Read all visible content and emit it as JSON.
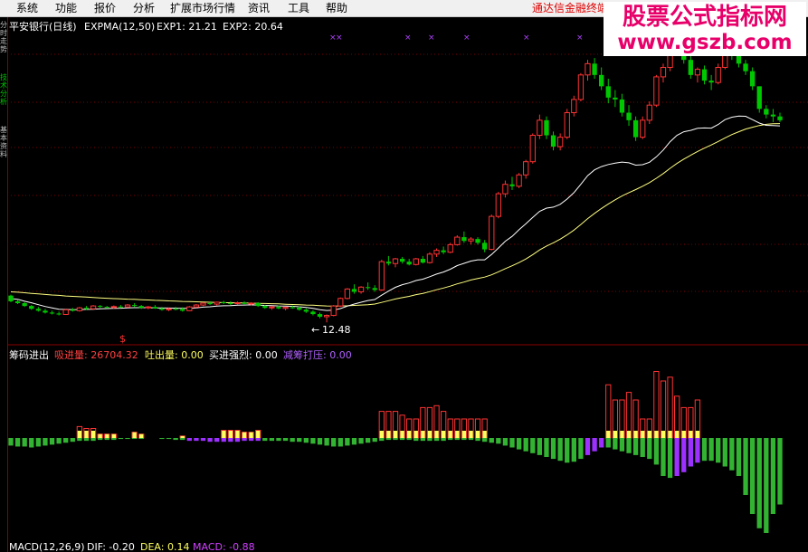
{
  "menu": [
    "系统",
    "功能",
    "报价",
    "分析",
    "扩展市场行情",
    "资讯",
    "工具",
    "帮助"
  ],
  "broker": "通达信金融终端",
  "watermark": {
    "title": "股票公式指标网",
    "url": "www.gszb.com"
  },
  "sidebar_tabs": [
    "分时走势",
    "技术分析",
    "基本资料"
  ],
  "price_panel": {
    "title": "平安银行(日线)",
    "indicator": "EXPMA(12,50)",
    "exp1_label": "EXP1: 21.21",
    "exp2_label": "EXP2: 20.64",
    "low_marker": "12.48",
    "dollar_mark": "$"
  },
  "chip_panel": {
    "title": "筹码进出",
    "absorb_label": "吸进量: 26704.32",
    "release_label": "吐出量: 0.00",
    "buy_strength_label": "买进强烈: 0.00",
    "reduce_label": "减筹打压: 0.00"
  },
  "macd_panel": {
    "label": "MACD(12,26,9)",
    "dif_label": "DIF: -0.20",
    "dea_label": "DEA: 0.14",
    "macd_label": "MACD: -0.88"
  },
  "colors": {
    "up": "#ff3333",
    "down": "#00c800",
    "exp1": "#ffffff",
    "exp2": "#ffff80",
    "purple": "#9b30ff",
    "yellow": "#ffff60",
    "green_bar": "#32b432"
  },
  "chart_data": {
    "type": "candlestick",
    "candles": [
      [
        13.9,
        13.95,
        13.55,
        13.6
      ],
      [
        13.6,
        13.7,
        13.45,
        13.5
      ],
      [
        13.5,
        13.55,
        13.3,
        13.35
      ],
      [
        13.35,
        13.4,
        13.15,
        13.2
      ],
      [
        13.2,
        13.3,
        13.05,
        13.1
      ],
      [
        13.1,
        13.2,
        12.95,
        13.0
      ],
      [
        13.0,
        13.1,
        12.9,
        12.95
      ],
      [
        12.95,
        13.05,
        12.85,
        12.9
      ],
      [
        12.9,
        13.2,
        12.88,
        13.15
      ],
      [
        13.15,
        13.25,
        13.05,
        13.1
      ],
      [
        13.1,
        13.3,
        13.05,
        13.25
      ],
      [
        13.25,
        13.35,
        13.15,
        13.2
      ],
      [
        13.2,
        13.4,
        13.15,
        13.35
      ],
      [
        13.35,
        13.4,
        13.25,
        13.3
      ],
      [
        13.3,
        13.35,
        13.22,
        13.28
      ],
      [
        13.28,
        13.38,
        13.2,
        13.32
      ],
      [
        13.32,
        13.4,
        13.25,
        13.3
      ],
      [
        13.3,
        13.45,
        13.26,
        13.4
      ],
      [
        13.4,
        13.5,
        13.3,
        13.35
      ],
      [
        13.35,
        13.4,
        13.2,
        13.25
      ],
      [
        13.25,
        13.35,
        13.18,
        13.3
      ],
      [
        13.3,
        13.4,
        13.2,
        13.22
      ],
      [
        13.22,
        13.3,
        13.1,
        13.15
      ],
      [
        13.15,
        13.25,
        13.08,
        13.2
      ],
      [
        13.2,
        13.3,
        13.12,
        13.18
      ],
      [
        13.18,
        13.28,
        13.05,
        13.1
      ],
      [
        13.1,
        13.35,
        13.08,
        13.3
      ],
      [
        13.3,
        13.45,
        13.25,
        13.4
      ],
      [
        13.4,
        13.55,
        13.35,
        13.5
      ],
      [
        13.5,
        13.6,
        13.4,
        13.45
      ],
      [
        13.45,
        13.58,
        13.38,
        13.55
      ],
      [
        13.55,
        13.62,
        13.45,
        13.5
      ],
      [
        13.5,
        13.6,
        13.4,
        13.48
      ],
      [
        13.48,
        13.58,
        13.42,
        13.52
      ],
      [
        13.52,
        13.6,
        13.44,
        13.46
      ],
      [
        13.46,
        13.55,
        13.38,
        13.5
      ],
      [
        13.5,
        13.55,
        13.3,
        13.35
      ],
      [
        13.35,
        13.4,
        13.2,
        13.25
      ],
      [
        13.25,
        13.35,
        13.15,
        13.3
      ],
      [
        13.3,
        13.38,
        13.18,
        13.22
      ],
      [
        13.22,
        13.32,
        13.12,
        13.28
      ],
      [
        13.28,
        13.38,
        13.2,
        13.26
      ],
      [
        13.26,
        13.34,
        13.1,
        13.15
      ],
      [
        13.15,
        13.22,
        12.98,
        13.05
      ],
      [
        13.05,
        13.12,
        12.85,
        12.92
      ],
      [
        12.92,
        13.0,
        12.7,
        12.78
      ],
      [
        12.78,
        12.9,
        12.48,
        12.85
      ],
      [
        12.85,
        13.4,
        12.8,
        13.35
      ],
      [
        13.35,
        13.8,
        13.3,
        13.75
      ],
      [
        13.75,
        14.3,
        13.7,
        14.25
      ],
      [
        14.25,
        14.5,
        14.0,
        14.1
      ],
      [
        14.1,
        14.4,
        14.0,
        14.35
      ],
      [
        14.35,
        14.6,
        14.2,
        14.3
      ],
      [
        14.3,
        14.45,
        14.1,
        14.2
      ],
      [
        14.2,
        15.8,
        14.15,
        15.7
      ],
      [
        15.7,
        16.0,
        15.5,
        15.6
      ],
      [
        15.6,
        15.9,
        15.4,
        15.85
      ],
      [
        15.85,
        15.95,
        15.6,
        15.7
      ],
      [
        15.7,
        15.85,
        15.5,
        15.55
      ],
      [
        15.55,
        15.9,
        15.5,
        15.85
      ],
      [
        15.85,
        16.0,
        15.6,
        15.65
      ],
      [
        15.65,
        16.2,
        15.6,
        16.1
      ],
      [
        16.1,
        16.4,
        15.95,
        16.3
      ],
      [
        16.3,
        16.5,
        16.1,
        16.2
      ],
      [
        16.2,
        16.7,
        16.15,
        16.6
      ],
      [
        16.6,
        17.1,
        16.55,
        17.0
      ],
      [
        17.0,
        17.3,
        16.7,
        16.8
      ],
      [
        16.8,
        17.0,
        16.6,
        16.9
      ],
      [
        16.9,
        17.0,
        16.6,
        16.7
      ],
      [
        16.7,
        16.85,
        16.2,
        16.35
      ],
      [
        16.35,
        18.2,
        16.3,
        18.1
      ],
      [
        18.1,
        19.4,
        18.0,
        19.3
      ],
      [
        19.3,
        20.0,
        19.1,
        19.8
      ],
      [
        19.8,
        20.2,
        19.5,
        19.7
      ],
      [
        19.7,
        20.4,
        19.6,
        20.3
      ],
      [
        20.3,
        21.1,
        20.1,
        21.0
      ],
      [
        21.0,
        22.5,
        20.9,
        22.4
      ],
      [
        22.4,
        23.5,
        22.2,
        23.2
      ],
      [
        23.2,
        23.4,
        22.2,
        22.4
      ],
      [
        22.4,
        22.6,
        21.6,
        21.8
      ],
      [
        21.8,
        22.5,
        21.6,
        22.3
      ],
      [
        22.3,
        23.8,
        22.2,
        23.6
      ],
      [
        23.6,
        24.5,
        23.4,
        24.3
      ],
      [
        24.3,
        25.7,
        24.2,
        25.6
      ],
      [
        25.6,
        26.4,
        25.3,
        26.2
      ],
      [
        26.2,
        26.5,
        25.4,
        25.6
      ],
      [
        25.6,
        26.0,
        24.8,
        25.0
      ],
      [
        25.0,
        25.4,
        24.1,
        24.4
      ],
      [
        24.4,
        24.8,
        23.9,
        24.3
      ],
      [
        24.3,
        24.6,
        23.4,
        23.6
      ],
      [
        23.6,
        24.0,
        22.9,
        23.2
      ],
      [
        23.2,
        23.4,
        22.1,
        22.3
      ],
      [
        22.3,
        23.4,
        22.2,
        23.2
      ],
      [
        23.2,
        24.2,
        23.0,
        24.0
      ],
      [
        24.0,
        25.6,
        23.9,
        25.5
      ],
      [
        25.5,
        26.2,
        25.2,
        26.0
      ],
      [
        26.0,
        27.6,
        25.8,
        27.4
      ],
      [
        27.4,
        28.1,
        27.0,
        27.3
      ],
      [
        27.3,
        27.6,
        26.2,
        26.4
      ],
      [
        26.4,
        26.8,
        25.4,
        25.6
      ],
      [
        25.6,
        26.0,
        25.2,
        25.9
      ],
      [
        25.9,
        26.1,
        25.1,
        25.3
      ],
      [
        25.3,
        25.6,
        24.8,
        25.2
      ],
      [
        25.2,
        26.2,
        25.1,
        26.0
      ],
      [
        26.0,
        27.0,
        25.9,
        26.8
      ],
      [
        26.8,
        27.2,
        26.4,
        26.6
      ],
      [
        26.6,
        27.0,
        26.0,
        26.2
      ],
      [
        26.2,
        26.4,
        25.6,
        25.8
      ],
      [
        25.8,
        26.0,
        24.8,
        25.0
      ],
      [
        25.0,
        24.8,
        23.6,
        23.8
      ],
      [
        23.8,
        24.0,
        23.3,
        23.5
      ],
      [
        23.5,
        23.8,
        23.1,
        23.4
      ],
      [
        23.4,
        23.6,
        23.1,
        23.2
      ]
    ],
    "exp1": [
      13.74,
      13.7,
      13.6,
      13.52,
      13.42,
      13.32,
      13.25,
      13.18,
      13.17,
      13.15,
      13.16,
      13.17,
      13.18,
      13.2,
      13.21,
      13.22,
      13.23,
      13.25,
      13.26,
      13.26,
      13.26,
      13.25,
      13.24,
      13.24,
      13.23,
      13.22,
      13.23,
      13.25,
      13.29,
      13.31,
      13.34,
      13.36,
      13.37,
      13.39,
      13.4,
      13.41,
      13.4,
      13.38,
      13.37,
      13.35,
      13.34,
      13.33,
      13.31,
      13.27,
      13.22,
      13.15,
      13.11,
      13.13,
      13.21,
      13.34,
      13.45,
      13.55,
      13.64,
      13.69,
      13.92,
      14.14,
      14.34,
      14.48,
      14.57,
      14.7,
      14.77,
      14.9,
      15.04,
      15.15,
      15.3,
      15.49,
      15.61,
      15.73,
      15.8,
      15.8,
      16.08,
      16.42,
      16.78,
      17.04,
      17.39,
      17.71,
      18.05,
      18.37,
      18.54,
      18.59,
      18.74,
      19.02,
      19.36,
      19.8,
      20.26,
      20.57,
      20.74,
      20.85,
      20.93,
      20.98,
      20.94,
      20.82,
      20.84,
      20.97,
      21.26,
      21.62,
      22.06,
      22.4,
      22.59,
      22.66,
      22.77,
      22.79,
      22.78,
      22.97,
      23.23,
      23.36,
      23.42,
      23.41,
      23.23,
      23.05,
      22.93,
      22.92,
      22.9
    ],
    "exp2": [
      14.1,
      14.08,
      14.05,
      14.02,
      13.99,
      13.96,
      13.93,
      13.91,
      13.88,
      13.86,
      13.84,
      13.82,
      13.8,
      13.78,
      13.76,
      13.74,
      13.73,
      13.71,
      13.7,
      13.68,
      13.67,
      13.65,
      13.64,
      13.62,
      13.61,
      13.59,
      13.58,
      13.57,
      13.56,
      13.55,
      13.54,
      13.53,
      13.52,
      13.52,
      13.51,
      13.5,
      13.49,
      13.48,
      13.47,
      13.46,
      13.44,
      13.43,
      13.42,
      13.4,
      13.39,
      13.37,
      13.35,
      13.34,
      13.35,
      13.36,
      13.38,
      13.4,
      13.42,
      13.45,
      13.54,
      13.63,
      13.72,
      13.79,
      13.86,
      13.95,
      14.02,
      14.11,
      14.21,
      14.3,
      14.4,
      14.52,
      14.62,
      14.73,
      14.81,
      14.88,
      15.0,
      15.16,
      15.33,
      15.48,
      15.65,
      15.84,
      16.07,
      16.32,
      16.53,
      16.7,
      16.89,
      17.12,
      17.37,
      17.67,
      17.98,
      18.26,
      18.52,
      18.76,
      18.98,
      19.18,
      19.36,
      19.52,
      19.7,
      19.89,
      20.12,
      20.37,
      20.65,
      20.91,
      21.14,
      21.34,
      21.54,
      21.72,
      21.89,
      22.07,
      22.26,
      22.44,
      22.59,
      22.73,
      22.83,
      22.92,
      22.98,
      23.01,
      23.02
    ],
    "chip_absorb": [
      0,
      0,
      0,
      0,
      0,
      0,
      0,
      0,
      0,
      0,
      6,
      5,
      5,
      2,
      2,
      2,
      0,
      0,
      3,
      2,
      0,
      0,
      0,
      0,
      0,
      1,
      0,
      0,
      0,
      0,
      0,
      4,
      4,
      4,
      3,
      3,
      4,
      0,
      0,
      0,
      0,
      0,
      0,
      0,
      0,
      0,
      0,
      0,
      0,
      0,
      0,
      0,
      0,
      0,
      14,
      14,
      14,
      12,
      10,
      10,
      16,
      16,
      17,
      14,
      10,
      10,
      10,
      10,
      10,
      10,
      0,
      0,
      0,
      0,
      0,
      0,
      0,
      0,
      0,
      0,
      0,
      0,
      0,
      0,
      0,
      0,
      0,
      28,
      20,
      20,
      24,
      20,
      10,
      10,
      35,
      30,
      32,
      22,
      16,
      16,
      20,
      0,
      0,
      0,
      0,
      0,
      0,
      0,
      0,
      0,
      0,
      0,
      0
    ],
    "chip_yellow": [
      0,
      0,
      0,
      0,
      0,
      0,
      0,
      0,
      0,
      0,
      0,
      0,
      0,
      0,
      0,
      0,
      0,
      0,
      0,
      0,
      0,
      0,
      0,
      0,
      0,
      0,
      0,
      0,
      0,
      0,
      0,
      0,
      0,
      0,
      0,
      0,
      0,
      0,
      0,
      0,
      0,
      0,
      0,
      0,
      0,
      0,
      0,
      0,
      0,
      0,
      0,
      0,
      0,
      0,
      0,
      0,
      0,
      0,
      0,
      0,
      0,
      0,
      0,
      0,
      0,
      0,
      0,
      0,
      0,
      0,
      0,
      0,
      0,
      0,
      0,
      0,
      0,
      0,
      0,
      0,
      0,
      0,
      0,
      0,
      0,
      0,
      0,
      0,
      0,
      0,
      0,
      0,
      0,
      0,
      0,
      0,
      0,
      0,
      0,
      0,
      0,
      0,
      0,
      0,
      0,
      0,
      0,
      0,
      0,
      0,
      0,
      0,
      0
    ],
    "macd": [
      -8,
      -9,
      -9,
      -10,
      -9,
      -8,
      -7,
      -6,
      -5,
      -4,
      -3,
      -3,
      -3,
      -2,
      -2,
      -2,
      -1,
      -1,
      -1,
      -1,
      0,
      0,
      -1,
      -1,
      -2,
      -2,
      -3,
      -3,
      -3,
      -4,
      -4,
      -4,
      -4,
      -4,
      -3,
      -3,
      -3,
      -3,
      -3,
      -3,
      -3,
      -4,
      -4,
      -5,
      -6,
      -7,
      -8,
      -9,
      -9,
      -8,
      -7,
      -6,
      -5,
      -4,
      -3,
      -2,
      -2,
      -2,
      -2,
      -3,
      -3,
      -3,
      -3,
      -3,
      -2,
      -2,
      -2,
      -2,
      -3,
      -4,
      -5,
      -6,
      -8,
      -10,
      -12,
      -14,
      -16,
      -18,
      -20,
      -22,
      -24,
      -26,
      -25,
      -22,
      -18,
      -14,
      -10,
      -10,
      -12,
      -14,
      -16,
      -18,
      -20,
      -22,
      -28,
      -40,
      -42,
      -40,
      -36,
      -30,
      -26,
      -24,
      -24,
      -26,
      -30,
      -34,
      -40,
      -60,
      -80,
      -95,
      -100,
      -80,
      -70
    ]
  }
}
